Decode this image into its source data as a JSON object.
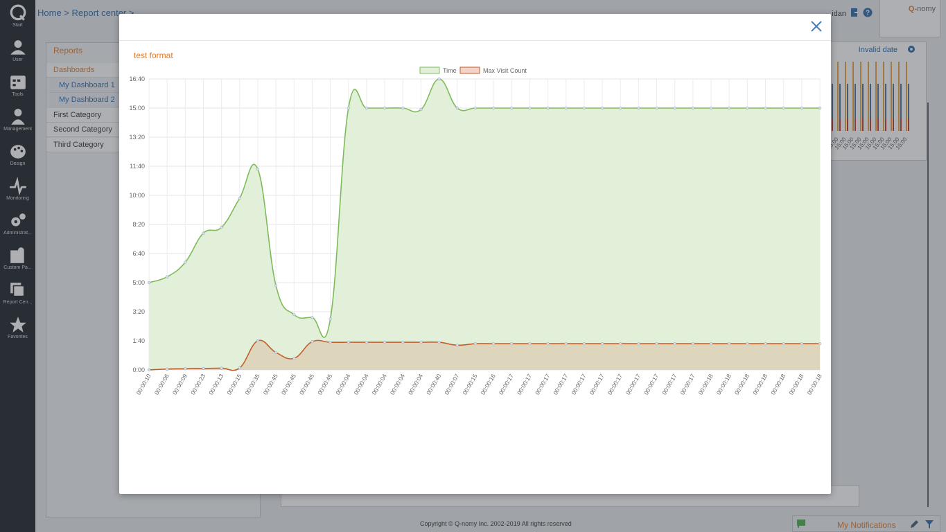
{
  "nav": {
    "items": [
      {
        "label": "Start",
        "icon": "q-logo-icon"
      },
      {
        "label": "User",
        "icon": "user-icon"
      },
      {
        "label": "Tools",
        "icon": "tools-icon"
      },
      {
        "label": "Management",
        "icon": "management-icon"
      },
      {
        "label": "Design",
        "icon": "palette-icon"
      },
      {
        "label": "Monitoring",
        "icon": "pulse-icon"
      },
      {
        "label": "Administrat...",
        "icon": "gears-icon"
      },
      {
        "label": "Custom Pa...",
        "icon": "puzzle-icon"
      },
      {
        "label": "Report Cen...",
        "icon": "reports-icon"
      },
      {
        "label": "Favorites",
        "icon": "star-icon"
      }
    ]
  },
  "header": {
    "breadcrumb": "Home > Report center >",
    "username": "idan",
    "logo": {
      "prefix": "Q-",
      "name": "nomy"
    }
  },
  "reports_panel": {
    "title": "Reports",
    "items": [
      {
        "label": "Dashboards",
        "kind": "head"
      },
      {
        "label": "My Dashboard 1",
        "kind": "sub"
      },
      {
        "label": "My Dashboard 2",
        "kind": "sub"
      },
      {
        "label": "First Category",
        "kind": "cat"
      },
      {
        "label": "Second Category",
        "kind": "cat"
      },
      {
        "label": "Third Category",
        "kind": "cat"
      }
    ]
  },
  "right_panel": {
    "invalid_date": "Invalid date",
    "tick_label": "15:00"
  },
  "footer": {
    "copyright": "Copyright © Q-nomy Inc. 2002-2019 All rights reserved",
    "notifications": "My Notifications"
  },
  "colors": {
    "accent": "#e07b2a",
    "link": "#2c6aa8",
    "time_line": "#7dbb59",
    "time_fill": "#e2f0d9",
    "visit_line": "#c35d2a",
    "visit_fill": "#ddd3b8"
  },
  "modal": {
    "title": "test format"
  },
  "chart_data": {
    "type": "area",
    "title": "test format",
    "legend": [
      "Time",
      "Max Visit Count"
    ],
    "legend_position": "top",
    "grid": true,
    "y_ticks": [
      "0:00",
      "1:40",
      "3:20",
      "5:00",
      "6:40",
      "8:20",
      "10:00",
      "11:40",
      "13:20",
      "15:00",
      "16:40"
    ],
    "ylim_seconds": [
      0,
      1000
    ],
    "x": [
      "00:00:10",
      "00:00:06",
      "00:00:09",
      "00:00:23",
      "00:00:13",
      "00:00:15",
      "00:00:35",
      "00:00:45",
      "00:00:45",
      "00:00:45",
      "00:00:45",
      "00:00:04",
      "00:00:04",
      "00:00:04",
      "00:00:04",
      "00:00:04",
      "00:00:40",
      "00:00:07",
      "00:00:15",
      "00:00:16",
      "00:00:17",
      "00:00:17",
      "00:00:17",
      "00:00:17",
      "00:00:17",
      "00:00:17",
      "00:00:17",
      "00:00:17",
      "00:00:17",
      "00:00:17",
      "00:00:17",
      "00:00:18",
      "00:00:18",
      "00:00:18",
      "00:00:18",
      "00:00:18",
      "00:00:18",
      "00:00:18"
    ],
    "series": [
      {
        "name": "Time",
        "values_seconds": [
          300,
          320,
          370,
          470,
          490,
          590,
          690,
          290,
          190,
          180,
          175,
          900,
          900,
          900,
          900,
          895,
          1000,
          900,
          900,
          900,
          900,
          900,
          900,
          900,
          900,
          900,
          900,
          900,
          900,
          900,
          900,
          900,
          900,
          900,
          900,
          900,
          900,
          900
        ]
      },
      {
        "name": "Max Visit Count",
        "values_seconds": [
          0,
          3,
          4,
          5,
          6,
          7,
          100,
          60,
          40,
          97,
          95,
          95,
          95,
          95,
          95,
          95,
          95,
          85,
          90,
          90,
          90,
          90,
          90,
          90,
          90,
          90,
          90,
          90,
          90,
          90,
          90,
          90,
          90,
          90,
          90,
          90,
          90,
          90
        ]
      }
    ]
  }
}
